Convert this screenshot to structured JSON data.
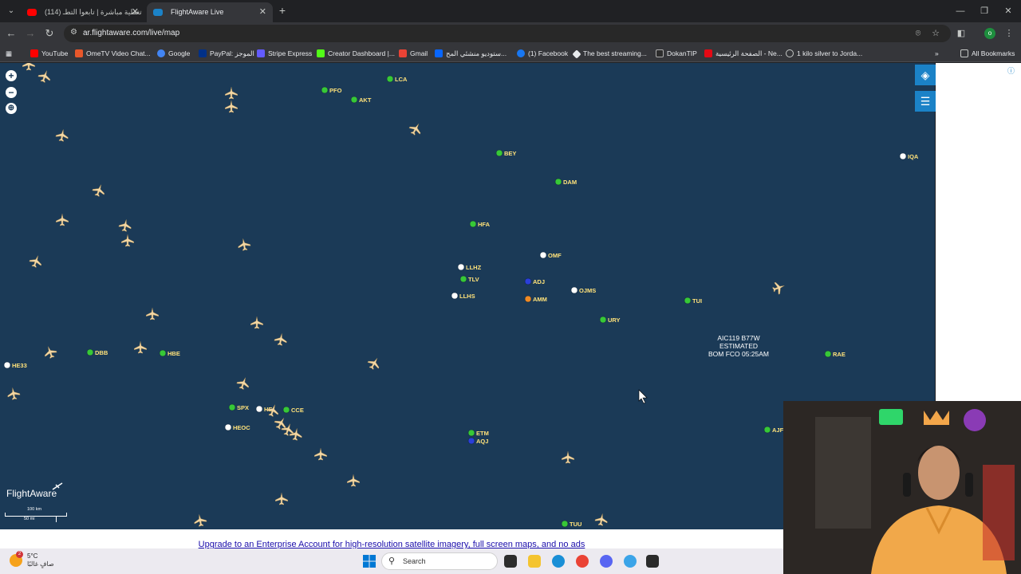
{
  "browser": {
    "tabs": [
      {
        "title": "تغطية مباشرة | تابعوا التطـ (114)",
        "active": false
      },
      {
        "title": "FlightAware Live",
        "active": true
      }
    ],
    "url": "ar.flightaware.com/live/map",
    "profile_initial": "o",
    "bookmarks": [
      "YouTube",
      "OmeTV Video Chat...",
      "Google",
      "PayPal: الموجز",
      "Stripe Express",
      "Creator Dashboard |...",
      "Gmail",
      "ستوديو منشئي المح...",
      "(1) Facebook",
      "The best streaming...",
      "DokanTIP",
      "الصفحة الرئيسية - Ne...",
      "1 kilo silver to Jorda..."
    ],
    "all_bookmarks": "All Bookmarks"
  },
  "map": {
    "airports": [
      {
        "code": "LCA",
        "status": "green"
      },
      {
        "code": "PFO",
        "status": "green"
      },
      {
        "code": "AKT",
        "status": "green"
      },
      {
        "code": "BEY",
        "status": "green"
      },
      {
        "code": "DAM",
        "status": "green"
      },
      {
        "code": "IQA",
        "status": "white"
      },
      {
        "code": "HFA",
        "status": "green"
      },
      {
        "code": "OMF",
        "status": "white"
      },
      {
        "code": "LLHZ",
        "status": "white"
      },
      {
        "code": "TLV",
        "status": "green"
      },
      {
        "code": "ADJ",
        "status": "blue"
      },
      {
        "code": "OJMS",
        "status": "white"
      },
      {
        "code": "LLHS",
        "status": "white"
      },
      {
        "code": "AMM",
        "status": "orange"
      },
      {
        "code": "TUI",
        "status": "green"
      },
      {
        "code": "URY",
        "status": "green"
      },
      {
        "code": "RAE",
        "status": "green"
      },
      {
        "code": "DBB",
        "status": "green"
      },
      {
        "code": "HBE",
        "status": "green"
      },
      {
        "code": "HE33",
        "status": "white"
      },
      {
        "code": "SPX",
        "status": "green"
      },
      {
        "code": "HE",
        "status": "white"
      },
      {
        "code": "CCE",
        "status": "green"
      },
      {
        "code": "HEOC",
        "status": "white"
      },
      {
        "code": "ETM",
        "status": "green"
      },
      {
        "code": "AQJ",
        "status": "blue"
      },
      {
        "code": "AJF",
        "status": "green"
      },
      {
        "code": "TUU",
        "status": "green"
      }
    ],
    "selected_flight": {
      "line1": "AIC119 B77W",
      "line2": "ESTIMATED",
      "line3": "BOM FCO 05:25AM"
    },
    "logo": "FlightAware",
    "scale": {
      "km": "100 km",
      "mi": "50 mi"
    },
    "controls": [
      "zoom-in",
      "zoom-out",
      "locate"
    ],
    "side_buttons": [
      "layers",
      "filters"
    ]
  },
  "upgrade_text": "Upgrade to an Enterprise Account for high-resolution satellite imagery, full screen maps, and no ads",
  "taskbar": {
    "weather_temp": "5°C",
    "weather_desc": "صافٍ غالبًا",
    "weather_badge": "2",
    "search_placeholder": "Search"
  },
  "colors": {
    "map_bg": "#1b3a57",
    "airport_green": "#37c837",
    "airport_white": "#ffffff",
    "airport_blue": "#2b3fd9",
    "airport_orange": "#f08a24",
    "plane": "#f3d7a4",
    "accent": "#1b82c7"
  }
}
